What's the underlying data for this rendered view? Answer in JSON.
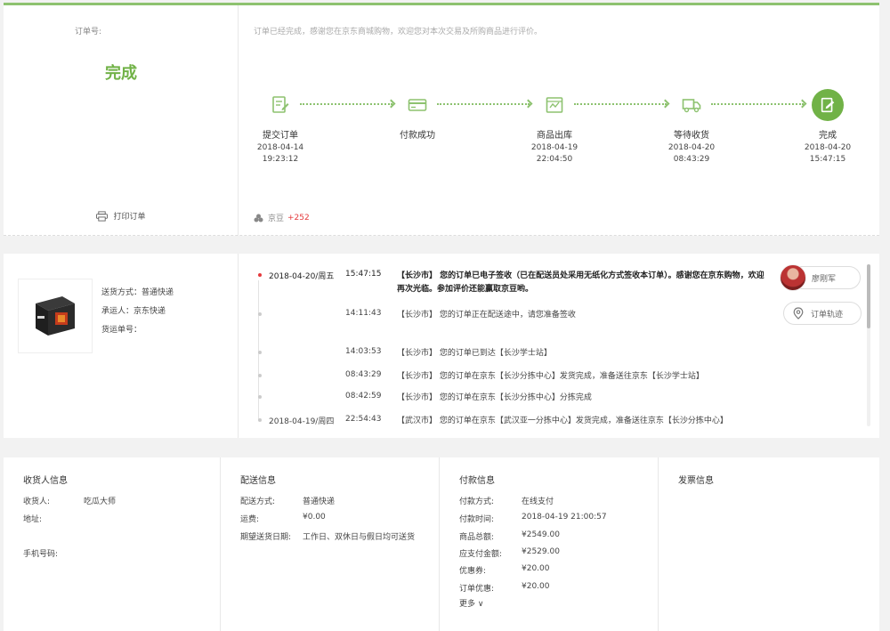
{
  "order": {
    "order_no_label": "订单号:",
    "status": "完成",
    "print_label": "打印订单",
    "status_note": "订单已经完成，感谢您在京东商城购物，欢迎您对本次交易及所购商品进行评价。",
    "jingdou_label": "京豆",
    "jingdou_value": "+252"
  },
  "steps": [
    {
      "name": "提交订单",
      "date": "2018-04-14",
      "time": "19:23:12",
      "icon": "order-submit-icon"
    },
    {
      "name": "付款成功",
      "date": "",
      "time": "",
      "icon": "payment-card-icon"
    },
    {
      "name": "商品出库",
      "date": "2018-04-19",
      "time": "22:04:50",
      "icon": "warehouse-box-icon"
    },
    {
      "name": "等待收货",
      "date": "2018-04-20",
      "time": "08:43:29",
      "icon": "delivery-truck-icon"
    },
    {
      "name": "完成",
      "date": "2018-04-20",
      "time": "15:47:15",
      "icon": "complete-check-icon"
    }
  ],
  "shipping_info": {
    "method": "送货方式：普通快递",
    "carrier": "承运人：京东快递",
    "tracking_no": "货运单号："
  },
  "tracking": [
    {
      "date": "2018-04-20/周五",
      "time": "15:47:15",
      "msg": "【长沙市】 您的订单已电子签收（已在配送员处采用无纸化方式签收本订单）。感谢您在京东购物，欢迎再次光临。参加评价还能赢取京豆哟。"
    },
    {
      "date": "",
      "time": "14:11:43",
      "msg": "【长沙市】 您的订单正在配送途中，请您准备签收"
    },
    {
      "date": "",
      "time": "14:03:53",
      "msg": "【长沙市】 您的订单已到达【长沙学士站】"
    },
    {
      "date": "",
      "time": "08:43:29",
      "msg": "【长沙市】 您的订单在京东【长沙分拣中心】发货完成，准备送往京东【长沙学士站】"
    },
    {
      "date": "",
      "time": "08:42:59",
      "msg": "【长沙市】 您的订单在京东【长沙分拣中心】分拣完成"
    },
    {
      "date": "2018-04-19/周四",
      "time": "22:54:43",
      "msg": "【武汉市】 您的订单在京东【武汉亚一分拣中心】发货完成，准备送往京东【长沙分拣中心】"
    }
  ],
  "courier": {
    "name": "廖刚军",
    "track_label": "订单轨迹"
  },
  "receiver": {
    "title": "收货人信息",
    "name_label": "收货人:",
    "name": "吃瓜大师",
    "address_label": "地址:",
    "phone_label": "手机号码:"
  },
  "delivery": {
    "title": "配送信息",
    "method_label": "配送方式:",
    "method": "普通快递",
    "fee_label": "运费:",
    "fee": "¥0.00",
    "date_label": "期望送货日期:",
    "date": "工作日、双休日与假日均可送货"
  },
  "payment": {
    "title": "付款信息",
    "method_label": "付款方式:",
    "method": "在线支付",
    "time_label": "付款时间:",
    "time": "2018-04-19 21:00:57",
    "total_label": "商品总额:",
    "total": "¥2549.00",
    "due_label": "应支付金额:",
    "due": "¥2529.00",
    "coupon_label": "优惠券:",
    "coupon": "¥20.00",
    "discount_label": "订单优惠:",
    "discount": "¥20.00",
    "more_label": "更多 ∨"
  },
  "invoice": {
    "title": "发票信息"
  },
  "colors": {
    "accent": "#71b247",
    "red": "#e4393c"
  }
}
